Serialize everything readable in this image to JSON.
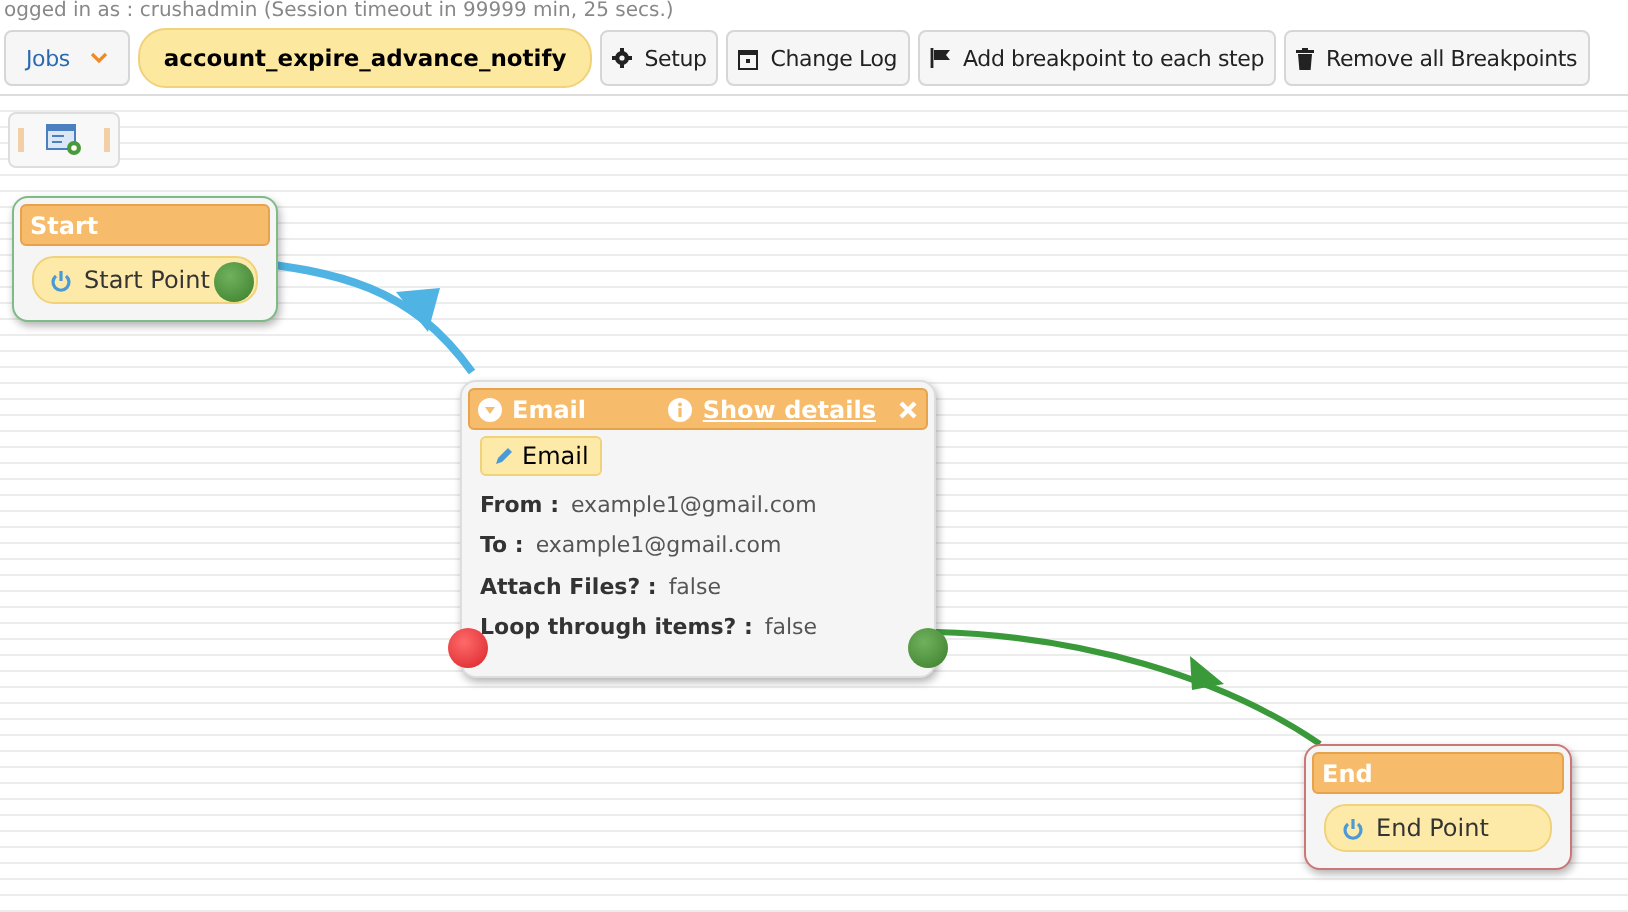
{
  "session_line": "ogged in as : crushadmin  (Session timeout in 99999 min, 25 secs.)",
  "toolbar": {
    "menu": "Jobs",
    "job_name": "account_expire_advance_notify",
    "buttons": [
      {
        "kind": "gear",
        "label": "Setup"
      },
      {
        "kind": "calendar",
        "label": "Change Log"
      },
      {
        "kind": "flag",
        "label": "Add breakpoint to each step"
      },
      {
        "kind": "trash",
        "label": "Remove all Breakpoints"
      }
    ]
  },
  "nodes": [
    {
      "kind": "start",
      "title": "Start",
      "label": "Start Point"
    },
    {
      "kind": "task",
      "title": "Email",
      "details_link": "Show details",
      "badge": "Email",
      "fields": [
        {
          "label": "From :",
          "value": "example1@gmail.com"
        },
        {
          "label": "To :",
          "value": "example1@gmail.com"
        },
        {
          "label": "Attach Files? :",
          "value": "false"
        },
        {
          "label": "Loop through items? :",
          "value": "false"
        }
      ]
    },
    {
      "kind": "end",
      "title": "End",
      "label": "End Point"
    }
  ]
}
